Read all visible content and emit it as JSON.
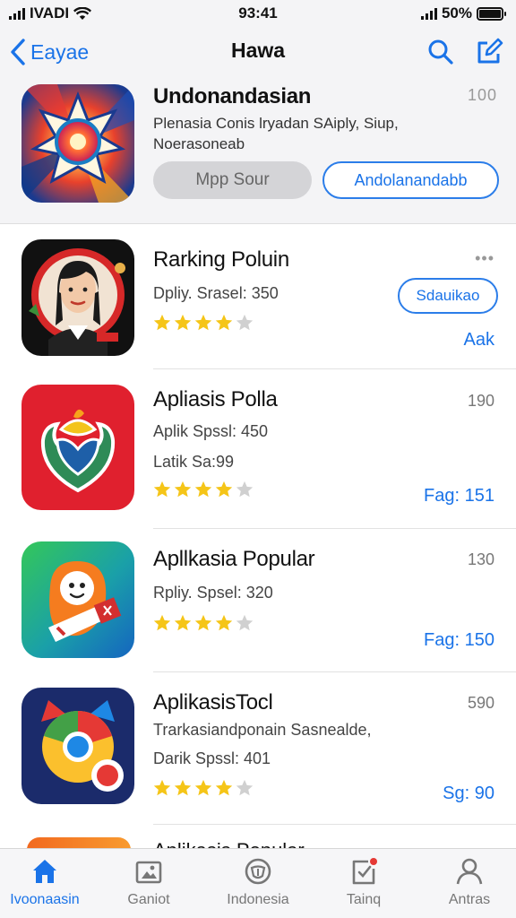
{
  "status_bar": {
    "carrier": "IVADI",
    "time": "93:41",
    "battery": "50%"
  },
  "nav": {
    "back_label": "Eayae",
    "title": "Hawa"
  },
  "featured": {
    "title": "Undonandasian",
    "subtitle": "Plenasia Conis lryadan SAiply, Siup, Noerasoneab",
    "more": "100",
    "button_left": "Mpp Sour",
    "button_right": "Andolanandabb"
  },
  "apps": [
    {
      "title": "Rarking Poluin",
      "line1": "Dpliy. Srasel: 350",
      "rating": 4,
      "right_top": "•••",
      "button": "Sdauikao",
      "right_bottom": "Aak"
    },
    {
      "title": "Apliasis Polla",
      "line1": "Aplik Spssl: 450",
      "line2": "Latik Sa:99",
      "rating": 4,
      "right_top": "190",
      "right_bottom": "Fag: 151"
    },
    {
      "title": "Apllkasia Popular",
      "line1": "Rpliy. Spsel: 320",
      "rating": 4,
      "right_top": "130",
      "right_bottom": "Fag: 150"
    },
    {
      "title": "AplikasisTocl",
      "line1": "Trarkasiandponain Sasnealde,",
      "line2": "Darik Spssl: 401",
      "rating": 4,
      "right_top": "590",
      "right_bottom": "Sg: 90"
    }
  ],
  "peek": {
    "title": "Aplikasis Popular"
  },
  "tabs": [
    {
      "label": "Ivoonaasin",
      "icon": "home-icon",
      "active": true
    },
    {
      "label": "Ganiot",
      "icon": "photo-icon",
      "active": false
    },
    {
      "label": "Indonesia",
      "icon": "shield-icon",
      "active": false
    },
    {
      "label": "Tainq",
      "icon": "updates-icon",
      "active": false
    },
    {
      "label": "Antras",
      "icon": "person-icon",
      "active": false
    }
  ],
  "colors": {
    "accent": "#1a73e8",
    "star": "#f5c518",
    "star_empty": "#d0d0d0",
    "background": "#f4f4f6"
  }
}
